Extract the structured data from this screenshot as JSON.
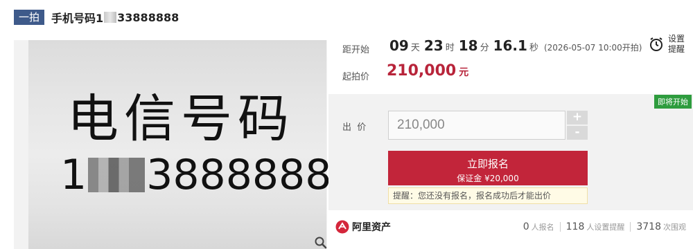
{
  "header": {
    "round_badge": "一拍",
    "title_prefix": "手机号码1",
    "title_suffix": "33888888"
  },
  "image": {
    "line1": "电信号码",
    "line2_prefix": "1",
    "line2_suffix": "3888888"
  },
  "countdown": {
    "label": "距开始",
    "days": "09",
    "days_unit": "天",
    "hours": "23",
    "hours_unit": "时",
    "minutes": "18",
    "minutes_unit": "分",
    "seconds": "16.1",
    "seconds_unit": "秒",
    "start_note": "(2026-05-07 10:00开拍)"
  },
  "reminder": {
    "label": "设置提醒",
    "icon": "alarm-clock-icon"
  },
  "start_price": {
    "label": "起拍价",
    "value": "210,000",
    "unit": "元"
  },
  "bid": {
    "status_tag": "即将开始",
    "label": "出  价",
    "input_value": "210,000",
    "plus": "+",
    "minus": "-"
  },
  "signup": {
    "main_label": "立即报名",
    "deposit_label": "保证金 ¥20,000"
  },
  "notice": {
    "text": "提醒：您还没有报名，报名成功后才能出价"
  },
  "footer": {
    "brand": "阿里资产",
    "signups_count": "0",
    "signups_label": "人报名",
    "reminders_count": "118",
    "reminders_label": "人设置提醒",
    "views_count": "3718",
    "views_label": "次围观"
  },
  "colors": {
    "accent_red": "#c2253a",
    "price_red": "#b8243a",
    "badge_blue": "#3e5a8a",
    "status_green": "#2e9c3e"
  }
}
